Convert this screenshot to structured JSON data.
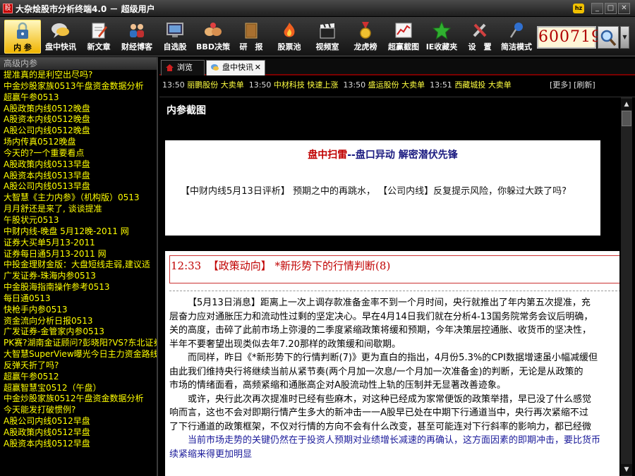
{
  "window": {
    "title": "大杂烩股市分析终端4.0  －  超级用户",
    "app_icon": "logo-icon",
    "badge": "hz",
    "minimize": "_",
    "maximize": "□",
    "close": "✕"
  },
  "toolbar": {
    "items": [
      {
        "label": "内 参",
        "icon": "lock-icon",
        "active": true
      },
      {
        "label": "盘中快讯",
        "icon": "chat-icon"
      },
      {
        "label": "新文章",
        "icon": "edit-document-icon"
      },
      {
        "label": "财经博客",
        "icon": "users-icon"
      },
      {
        "label": "自选股",
        "icon": "monitor-icon"
      },
      {
        "label": "BBD决策",
        "icon": "hands-icon"
      },
      {
        "label": "研　报",
        "icon": "book-icon"
      },
      {
        "label": "股票池",
        "icon": "fire-icon"
      },
      {
        "label": "视频室",
        "icon": "clapper-icon"
      },
      {
        "label": "龙虎榜",
        "icon": "medal-icon"
      },
      {
        "label": "超赢截图",
        "icon": "chart-icon"
      },
      {
        "label": "IE收藏夹",
        "icon": "star-icon"
      },
      {
        "label": "设　置",
        "icon": "tools-icon"
      },
      {
        "label": "简洁模式",
        "icon": "pin-icon"
      }
    ],
    "stock_code": "600719",
    "search_icon": "search-icon",
    "dropdown_glyph": "▼"
  },
  "sidebar": {
    "header": "高级内参",
    "items": [
      "提准真的是利空出尽吗?",
      "中金炒股家族0513午盘资金数据分析",
      "超赢午参0513",
      "A股政策内线0512晚盘",
      "A股资本内线0512晚盘",
      "A股公司内线0512晚盘",
      "场内传真0512晚盘",
      "今天的?一个重要看点",
      "A股政策内线0513早盘",
      "A股资本内线0513早盘",
      "A股公司内线0513早盘",
      "大智慧《主力内参》（机构版）0513",
      "月月舒还是来了, 谈谈提准",
      "午股状元0513",
      "中财内线-晚盘 5月12晚-2011 网",
      "证券大买单5月13-2011",
      "证券每日通5月13-2011 网",
      "中投金理财金版：大盘短线走弱,建议适",
      "广发证券-珠海内参0513",
      "中金股海指南操作参考0513",
      "每日通0513",
      "快枪手内参0513",
      "资金流向分析日报0513",
      "广发证券-金管家内参0513",
      "PK赛?湖南金证顾问?彭晓阳?VS?东北证券",
      "大智慧SuperView曝光今日主力资金路线",
      "反弹夭折了吗?",
      "超赢午参0512",
      "超赢智慧宝0512（午盘）",
      "中金炒股家族0512午盘资金数据分析",
      "今天能发打破惯例?",
      "A股公司内线0512早盘",
      "A股政策内线0512早盘",
      "A股资本内线0512早盘"
    ]
  },
  "tabs": [
    {
      "label": "浏览",
      "icon": "home-icon"
    },
    {
      "label": "盘中快讯",
      "icon": "chat-icon",
      "close": "✕"
    }
  ],
  "ticker": {
    "entries": [
      {
        "time": "13:50",
        "stock": "丽鹏股份",
        "action": "大卖单"
      },
      {
        "time": "13:50",
        "stock": "中材科技",
        "action": "快速上涨"
      },
      {
        "time": "13:50",
        "stock": "盛运股份",
        "action": "大卖单"
      },
      {
        "time": "13:51",
        "stock": "西藏城投",
        "action": "大卖单"
      }
    ],
    "more": "[更多]",
    "refresh": "[刷新]"
  },
  "doc": {
    "title": "内参截图",
    "scan": {
      "title_red": "盘中扫雷",
      "title_sep": "--",
      "title_blue": "盘口异动  解密潜伏先锋",
      "body": "【中财内线5月13日评析】 预期之中的再跳水， 【公司内线】反复提示风险，你躲过大跌了吗?"
    },
    "article": {
      "time": "12:33",
      "headline": "【政策动向】 *新形势下的行情判断(8)",
      "paragraphs": [
        "【5月13日消息】距离上一次上调存款准备金率不到一个月时间，央行就推出了年内第五次提准，充",
        "层奋力应对通胀压力和流动性过剩的坚定决心。早在4月14日我们就在分析4-13国务院常务会议后明确，",
        "关的高度，击碎了此前市场上弥漫的二季度紧缩政策将缓和预期，今年决策层控通胀、收货币的坚决性，",
        "半年不要奢望出现类似去年7.20那样的政策缓和间歇期。",
        "而同样，昨日《*新形势下的行情判断(7)》更为直白的指出，4月份5.3%的CPI数据增速虽小幅减缓但",
        "由此我们维持央行将继续当前从紧节奏(两个月加一次息/一个月加一次准备金)的判断，无论是从政策的",
        "市场的情绪面看，高频紧缩和通胀高企对A股流动性上轨的压制并无显著改善迹象。",
        "或许，央行此次再次提准时已经有些麻木，对这种已经成为家常便饭的政策举措，早已没了什么感觉",
        "响而言，这也不会对即期行情产生多大的新冲击一一A股早已处在中期下行通道当中，央行再次紧缩不过",
        "了下行通道的政策框架，不仅对行情的方向不会有什么改变，甚至可能连对下行斜率的影响力，都已经微",
        "当前市场走势的关键仍然在于投资人预期对业绩增长减速的再确认，这方面因素的即期冲击，要比货币",
        "续紧缩来得更加明显"
      ]
    }
  },
  "scrollbar": {
    "up": "▲",
    "down": "▼"
  },
  "colors": {
    "sidebar_text": "#ffff00",
    "headline_red": "#c00000",
    "active_tab_gold": "#f0b400"
  }
}
